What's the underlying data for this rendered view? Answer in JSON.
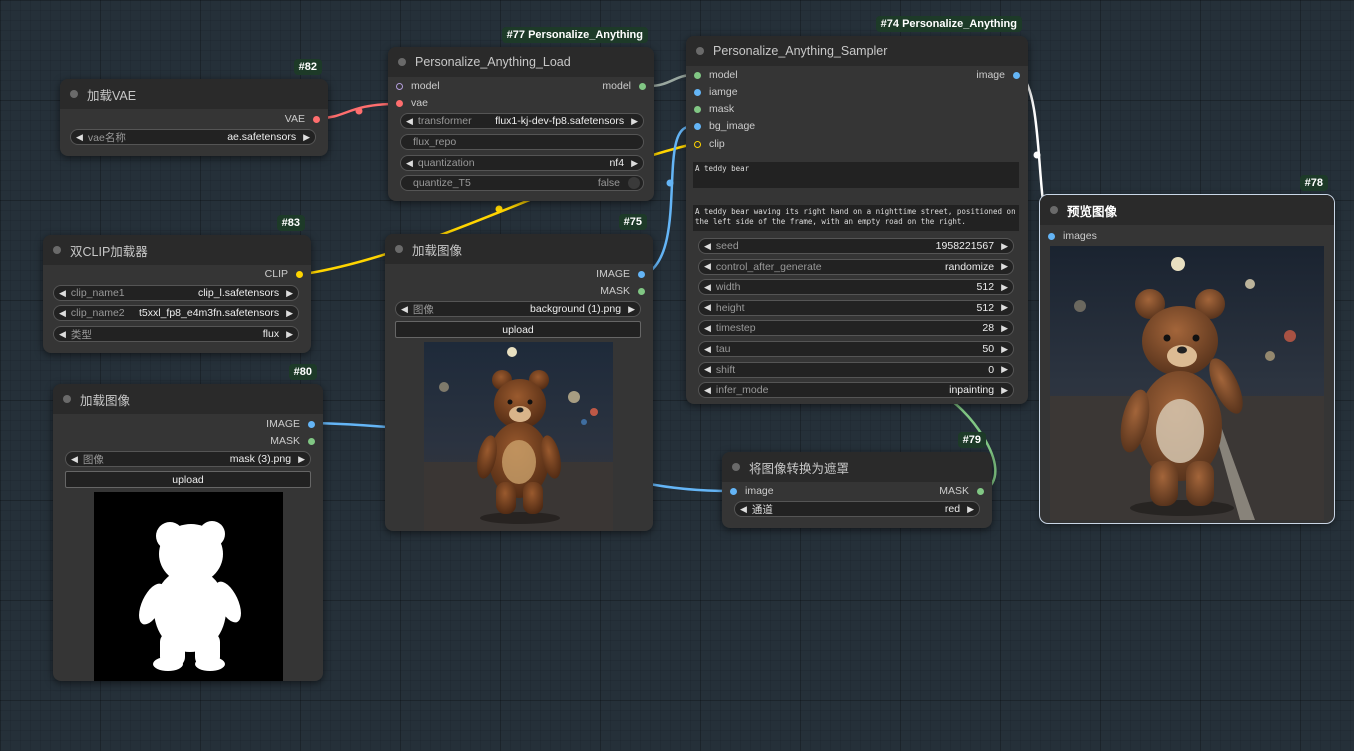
{
  "colors": {
    "canvas_bg": "#253039",
    "node_bg": "#353535",
    "node_header": "#2a2a2a",
    "badge_bg": "#1d3a28",
    "link_vae": "#ff6e6e",
    "link_clip": "#ffd500",
    "link_image": "#64b5f6",
    "link_mask": "#81c784",
    "link_model": "#b39ddb"
  },
  "nodes": {
    "vae_loader": {
      "badge": "#82",
      "title": "加载VAE",
      "output_vae": "VAE",
      "widget_vae_name_label": "vae名称",
      "widget_vae_name_value": "ae.safetensors"
    },
    "dual_clip": {
      "badge": "#83",
      "title": "双CLIP加载器",
      "output_clip": "CLIP",
      "clip_name1_label": "clip_name1",
      "clip_name1_value": "clip_l.safetensors",
      "clip_name2_label": "clip_name2",
      "clip_name2_value": "t5xxl_fp8_e4m3fn.safetensors",
      "type_label": "类型",
      "type_value": "flux"
    },
    "load_mask": {
      "badge": "#80",
      "title": "加载图像",
      "output_image": "IMAGE",
      "output_mask": "MASK",
      "image_label": "图像",
      "image_value": "mask (3).png",
      "upload_label": "upload"
    },
    "pa_load": {
      "badge": "#77 Personalize_Anything",
      "title": "Personalize_Anything_Load",
      "input_model": "model",
      "input_vae": "vae",
      "output_model": "model",
      "transformer_label": "transformer",
      "transformer_value": "flux1-kj-dev-fp8.safetensors",
      "flux_repo_label": "flux_repo",
      "quantization_label": "quantization",
      "quantization_value": "nf4",
      "quantize_t5_label": "quantize_T5",
      "quantize_t5_value": "false"
    },
    "load_bg": {
      "badge": "#75",
      "title": "加载图像",
      "output_image": "IMAGE",
      "output_mask": "MASK",
      "image_label": "图像",
      "image_value": "background (1).png",
      "upload_label": "upload"
    },
    "pa_sampler": {
      "badge": "#74 Personalize_Anything",
      "title": "Personalize_Anything_Sampler",
      "input_model": "model",
      "input_iamge": "iamge",
      "input_mask": "mask",
      "input_bg_image": "bg_image",
      "input_clip": "clip",
      "output_image": "image",
      "prompt1": "A teddy bear",
      "prompt2": "A teddy bear waving its right hand on a nighttime street, positioned on the left side of the frame, with an empty road on the right.",
      "widgets": [
        {
          "label": "seed",
          "value": "1958221567"
        },
        {
          "label": "control_after_generate",
          "value": "randomize"
        },
        {
          "label": "width",
          "value": "512"
        },
        {
          "label": "height",
          "value": "512"
        },
        {
          "label": "timestep",
          "value": "28"
        },
        {
          "label": "tau",
          "value": "50"
        },
        {
          "label": "shift",
          "value": "0"
        },
        {
          "label": "infer_mode",
          "value": "inpainting"
        }
      ]
    },
    "image_to_mask": {
      "badge": "#79",
      "title": "将图像转换为遮罩",
      "input_image": "image",
      "output_mask": "MASK",
      "channel_label": "通道",
      "channel_value": "red"
    },
    "preview": {
      "badge": "#78",
      "title": "预览图像",
      "input_images": "images"
    }
  }
}
